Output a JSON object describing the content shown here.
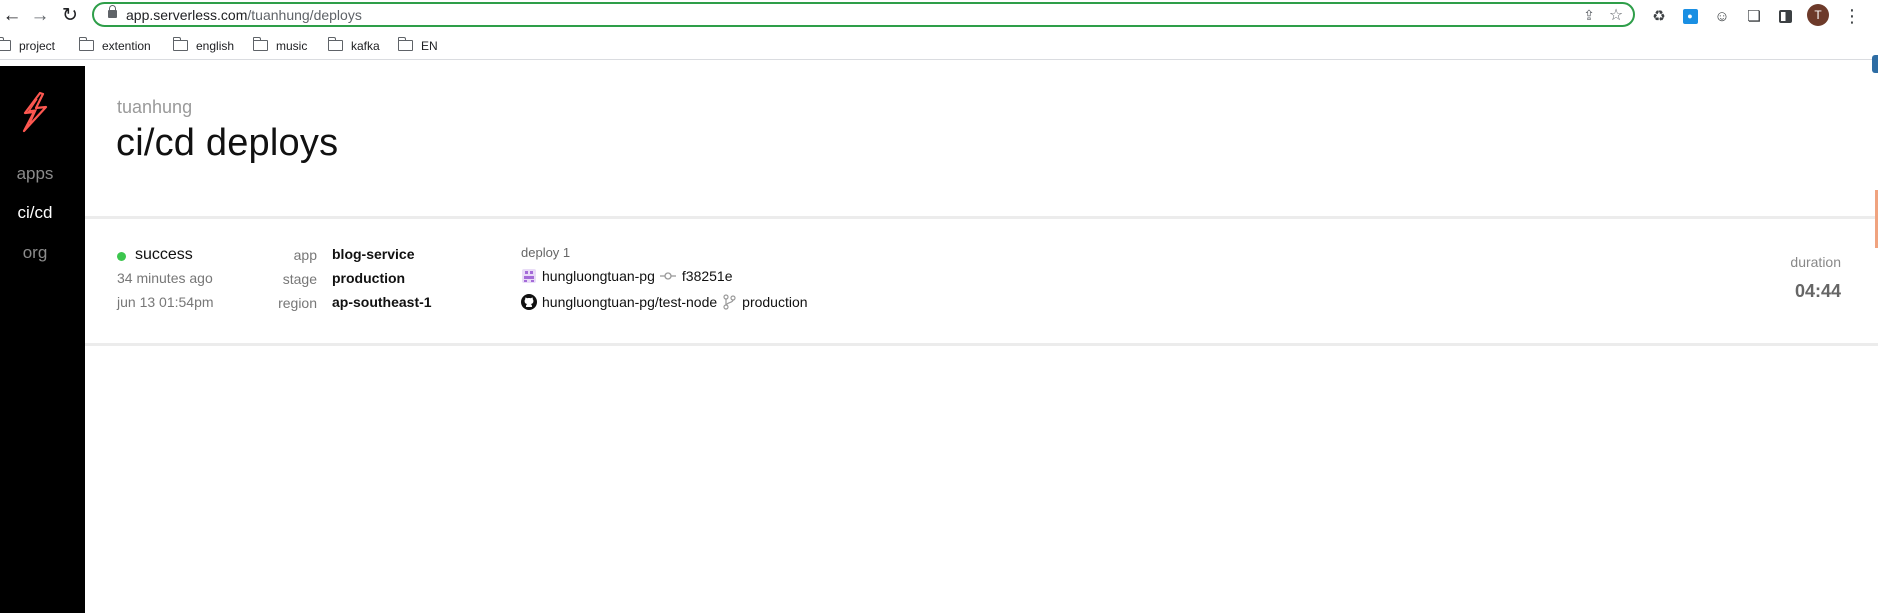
{
  "browser": {
    "url_host": "app.serverless.com",
    "url_path": "/tuanhung/deploys",
    "avatar_initial": "T",
    "icons": {
      "back": "back-arrow-icon",
      "forward": "forward-arrow-icon",
      "reload": "reload-icon",
      "share": "share-icon",
      "bookmark": "star-icon",
      "extensions": "puzzle-icon",
      "menu": "kebab-menu-icon"
    },
    "bookmarks": [
      "project",
      "extention",
      "english",
      "music",
      "kafka",
      "EN"
    ]
  },
  "sidebar": {
    "logo": "serverless-bolt-logo",
    "items": [
      {
        "label": "apps",
        "active": false
      },
      {
        "label": "ci/cd",
        "active": true
      },
      {
        "label": "org",
        "active": false
      }
    ]
  },
  "page": {
    "org_name": "tuanhung",
    "title": "ci/cd deploys"
  },
  "deploy": {
    "status": "success",
    "status_color": "#3cc64e",
    "relative_time": "34 minutes ago",
    "timestamp": "jun 13 01:54pm",
    "meta": [
      {
        "label": "app",
        "value": "blog-service"
      },
      {
        "label": "stage",
        "value": "production"
      },
      {
        "label": "region",
        "value": "ap-southeast-1"
      }
    ],
    "deploy_name": "deploy 1",
    "user": "hungluongtuan-pg",
    "commit": "f38251e",
    "repo": "hungluongtuan-pg/test-node",
    "branch": "production",
    "duration_label": "duration",
    "duration_value": "04:44"
  }
}
